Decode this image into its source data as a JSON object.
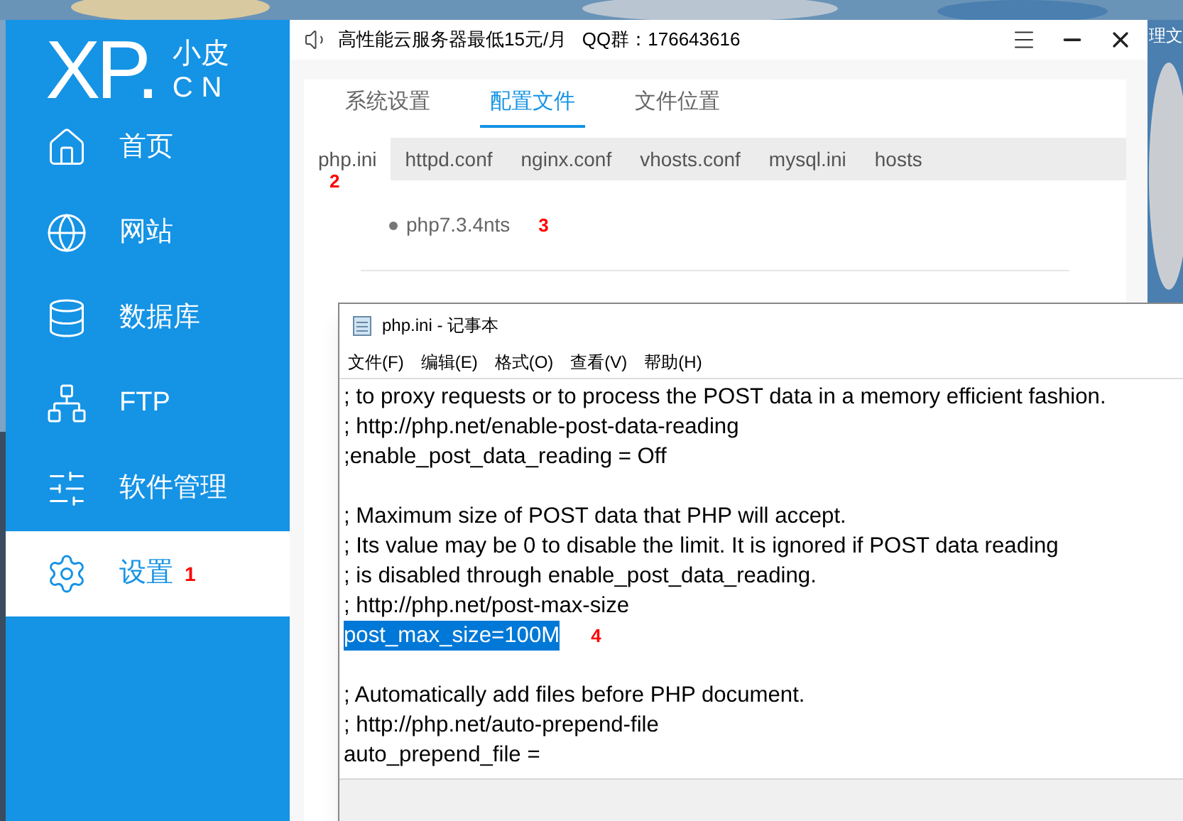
{
  "desktop": {
    "label": "理文"
  },
  "app": {
    "logo": {
      "mark": "XP",
      "dot": ".",
      "top": "小皮",
      "bottom": "CN"
    },
    "sidebar": {
      "items": [
        {
          "label": "首页",
          "selected": false
        },
        {
          "label": "网站",
          "selected": false
        },
        {
          "label": "数据库",
          "selected": false
        },
        {
          "label": "FTP",
          "selected": false
        },
        {
          "label": "软件管理",
          "selected": false
        },
        {
          "label": "设置",
          "selected": true,
          "annotation": "1"
        }
      ]
    },
    "notice": "高性能云服务器最低15元/月   QQ群：176643616",
    "tabs": [
      {
        "label": "系统设置",
        "selected": false
      },
      {
        "label": "配置文件",
        "selected": true
      },
      {
        "label": "文件位置",
        "selected": false
      }
    ],
    "file_tabs": [
      {
        "label": "php.ini",
        "selected": true,
        "annotation": "2"
      },
      {
        "label": "httpd.conf",
        "selected": false
      },
      {
        "label": "nginx.conf",
        "selected": false
      },
      {
        "label": "vhosts.conf",
        "selected": false
      },
      {
        "label": "mysql.ini",
        "selected": false
      },
      {
        "label": "hosts",
        "selected": false
      }
    ],
    "versions": [
      {
        "label": "php7.3.4nts",
        "annotation": "3"
      }
    ]
  },
  "notepad": {
    "title": "php.ini - 记事本",
    "menu": [
      "文件(F)",
      "编辑(E)",
      "格式(O)",
      "查看(V)",
      "帮助(H)"
    ],
    "lines": [
      {
        "kind": "text",
        "text": "; to proxy requests or to process the POST data in a memory efficient fashion.",
        "selected": false
      },
      {
        "kind": "text",
        "text": "; http://php.net/enable-post-data-reading",
        "selected": false
      },
      {
        "kind": "text",
        "text": ";enable_post_data_reading = Off",
        "selected": false
      },
      {
        "kind": "blank"
      },
      {
        "kind": "text",
        "text": "; Maximum size of POST data that PHP will accept.",
        "selected": false
      },
      {
        "kind": "text",
        "text": "; Its value may be 0 to disable the limit. It is ignored if POST data reading",
        "selected": false
      },
      {
        "kind": "text",
        "text": "; is disabled through enable_post_data_reading.",
        "selected": false
      },
      {
        "kind": "text",
        "text": "; http://php.net/post-max-size",
        "selected": false
      },
      {
        "kind": "text",
        "text": "post_max_size=100M",
        "selected": true,
        "annotation": "4"
      },
      {
        "kind": "blank"
      },
      {
        "kind": "text",
        "text": "; Automatically add files before PHP document.",
        "selected": false
      },
      {
        "kind": "text",
        "text": "; http://php.net/auto-prepend-file",
        "selected": false
      },
      {
        "kind": "text",
        "text": "auto_prepend_file =",
        "selected": false
      }
    ]
  }
}
